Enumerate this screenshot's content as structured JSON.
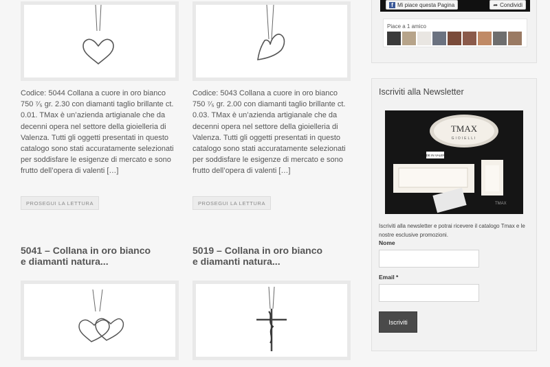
{
  "posts": [
    {
      "title": "",
      "excerpt": "Codice: 5044 Collana a cuore in oro bianco 750 ⁷⁄₅ gr. 2.30 con diamanti taglio brillante ct. 0.01. TMax è un’azienda artigianale che da decenni opera nel settore della gioielleria di Valenza. Tutti gli oggetti presentati in questo catalogo sono stati accuratamente selezionati per soddisfare le esigenze di mercato e sono frutto dell’opera di valenti […]",
      "readmore": "PROSEGUI LA LETTURA",
      "image_icon": "heart-necklace-icon"
    },
    {
      "title": "",
      "excerpt": "Codice: 5043 Collana a cuore in oro bianco 750 ⁷⁄₅ gr. 2.00 con diamanti taglio brillante ct. 0.03. TMax è un’azienda artigianale che da decenni opera nel settore della gioielleria di Valenza. Tutti gli oggetti presentati in questo catalogo sono stati accuratamente selezionati per soddisfare le esigenze di mercato e sono frutto dell’opera di valenti […]",
      "readmore": "PROSEGUI LA LETTURA",
      "image_icon": "tilted-heart-necklace-icon"
    },
    {
      "title_line1": "5041 – Collana in oro bianco",
      "title_line2": "e diamanti natura...",
      "image_icon": "double-heart-necklace-icon"
    },
    {
      "title_line1": "5019 – Collana in oro bianco",
      "title_line2": "e diamanti natura...",
      "image_icon": "cross-pendant-icon"
    }
  ],
  "facebook": {
    "like_label": "Mi piace questa Pagina",
    "share_label": "Condividi",
    "friends_caption": "Piace a 1 amico",
    "avatar_colors": [
      "#3a3a3a",
      "#b7a48a",
      "#e9e6e2",
      "#6b7280",
      "#7a4b3a",
      "#8b5a4a",
      "#c08a66",
      "#6e6e6e",
      "#9a7a63"
    ]
  },
  "newsletter": {
    "title": "Iscriviti alla Newsletter",
    "image_brand": "TMAX",
    "image_sub": "GIOIELLI",
    "image_badge": "MADE IN VALENZA",
    "description": "Iscriviti alla newsletter e potrai ricevere il catalogo Tmax e le nostre esclusive promozioni.",
    "name_label": "Nome",
    "email_label": "Email *",
    "name_value": "",
    "email_value": "",
    "submit_label": "Iscriviti"
  },
  "colors": {
    "background": "#f6f6f6",
    "button_dark": "#4a4a4a",
    "facebook_blue": "#3b5998"
  }
}
